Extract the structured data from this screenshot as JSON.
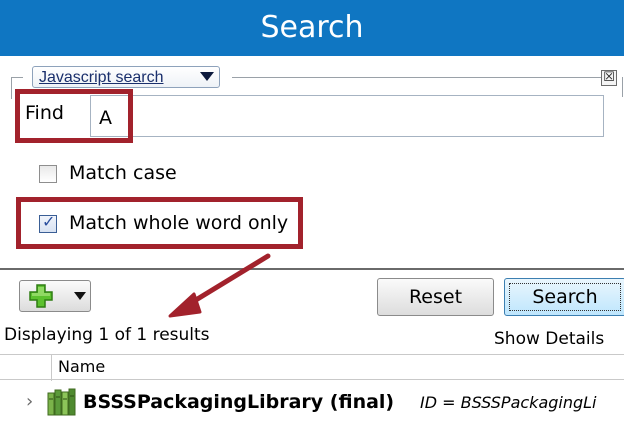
{
  "window": {
    "title": "Search"
  },
  "search_options": {
    "search_type": "Javascript search",
    "close_glyph": "☒",
    "find_label": "Find",
    "find_value": "A",
    "match_case_label": "Match case",
    "match_case_checked": false,
    "match_whole_word_label": "Match whole word only",
    "match_whole_word_checked": true
  },
  "toolbar": {
    "add_icon": "green-plus-icon",
    "reset_label": "Reset",
    "search_label": "Search"
  },
  "results": {
    "summary": "Displaying 1 of 1 results",
    "show_details_label": "Show Details",
    "columns": [
      "Name"
    ],
    "rows": [
      {
        "name": "BSSSPackagingLibrary (final)",
        "detail": "ID = BSSSPackagingLi",
        "icon": "library-books-icon"
      }
    ]
  },
  "annotations": {
    "highlight_color": "#a2222c"
  }
}
